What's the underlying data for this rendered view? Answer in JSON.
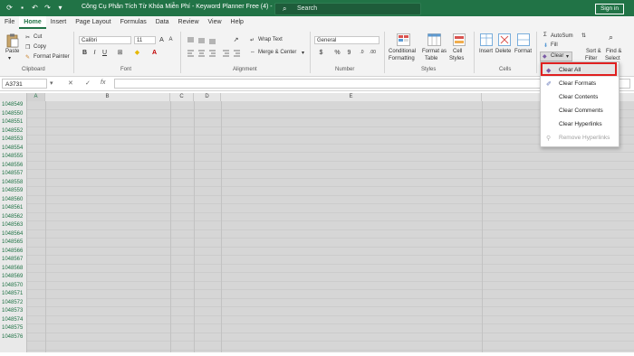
{
  "titlebar": {
    "title": "Công Cụ Phân Tích Từ Khóa Miễn Phí - Keyword Planner Free (4)  -  Excel",
    "search_placeholder": "Search",
    "sign_in": "Sign in"
  },
  "tabs": [
    {
      "label": "File",
      "active": false
    },
    {
      "label": "Home",
      "active": true
    },
    {
      "label": "Insert",
      "active": false
    },
    {
      "label": "Page Layout",
      "active": false
    },
    {
      "label": "Formulas",
      "active": false
    },
    {
      "label": "Data",
      "active": false
    },
    {
      "label": "Review",
      "active": false
    },
    {
      "label": "View",
      "active": false
    },
    {
      "label": "Help",
      "active": false
    }
  ],
  "ribbon": {
    "clipboard": {
      "paste": "Paste",
      "cut": "Cut",
      "copy": "Copy",
      "format_painter": "Format Painter",
      "group": "Clipboard"
    },
    "font": {
      "name": "Calibri",
      "size": "11",
      "bold": "B",
      "italic": "I",
      "underline": "U",
      "group": "Font"
    },
    "alignment": {
      "wrap_text": "Wrap Text",
      "merge_center": "Merge & Center",
      "group": "Alignment"
    },
    "number": {
      "format": "General",
      "currency": "$",
      "percent": "%",
      "comma": "9",
      "group": "Number"
    },
    "styles": {
      "conditional": "Conditional",
      "conditional2": "Formatting",
      "format_as": "Format as",
      "format_as2": "Table",
      "cell": "Cell",
      "cell2": "Styles",
      "group": "Styles"
    },
    "cells": {
      "insert": "Insert",
      "delete": "Delete",
      "format": "Format",
      "group": "Cells"
    },
    "editing": {
      "autosum": "AutoSum",
      "fill": "Fill",
      "clear": "Clear",
      "sort": "Sort &",
      "sort2": "Filter",
      "find": "Find &",
      "find2": "Select"
    }
  },
  "formula_bar": {
    "name_box": "A3731",
    "fx": "fx",
    "value": ""
  },
  "columns": [
    "A",
    "B",
    "C",
    "D",
    "E"
  ],
  "rows": [
    "1048549",
    "1048550",
    "1048551",
    "1048552",
    "1048553",
    "1048554",
    "1048555",
    "1048556",
    "1048557",
    "1048558",
    "1048559",
    "1048560",
    "1048561",
    "1048562",
    "1048563",
    "1048564",
    "1048565",
    "1048566",
    "1048567",
    "1048568",
    "1048569",
    "1048570",
    "1048571",
    "1048572",
    "1048573",
    "1048574",
    "1048575",
    "1048576"
  ],
  "clear_menu": {
    "items": [
      {
        "label": "Clear All",
        "icon": "eraser-icon",
        "state": "highlighted"
      },
      {
        "label": "Clear Formats",
        "icon": "clear-formats-icon",
        "state": "normal"
      },
      {
        "label": "Clear Contents",
        "icon": "none",
        "state": "normal"
      },
      {
        "label": "Clear Comments",
        "icon": "none",
        "state": "normal"
      },
      {
        "label": "Clear Hyperlinks",
        "icon": "none",
        "state": "normal"
      },
      {
        "label": "Remove Hyperlinks",
        "icon": "remove-hyperlinks-icon",
        "state": "disabled"
      }
    ]
  },
  "colors": {
    "excel_green": "#217346",
    "highlight_red": "#e02020"
  }
}
